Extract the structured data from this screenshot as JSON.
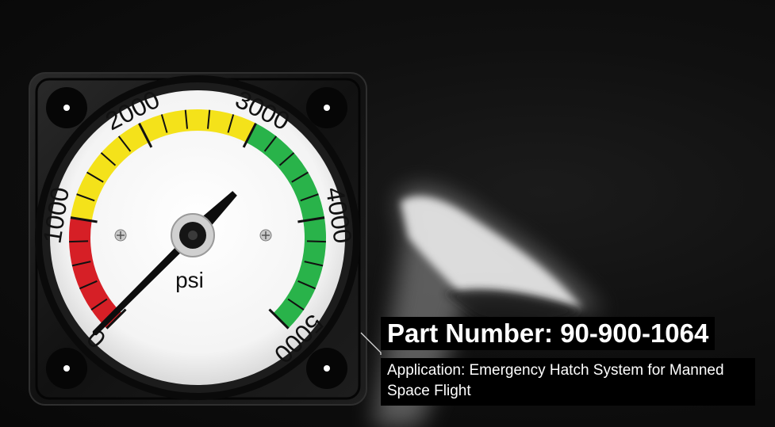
{
  "gauge": {
    "unit": "psi",
    "scale_labels": [
      "0",
      "1000",
      "2000",
      "3000",
      "4000",
      "5000"
    ],
    "reading": 0,
    "zones": [
      {
        "from": 0,
        "to": 1000,
        "color": "#d61f26"
      },
      {
        "from": 1000,
        "to": 3000,
        "color": "#f4e21a"
      },
      {
        "from": 3000,
        "to": 5000,
        "color": "#29b34a"
      }
    ]
  },
  "product": {
    "part_number": "Part Number: 90-900-1064",
    "application": "Application: Emergency Hatch System for Manned Space Flight"
  }
}
